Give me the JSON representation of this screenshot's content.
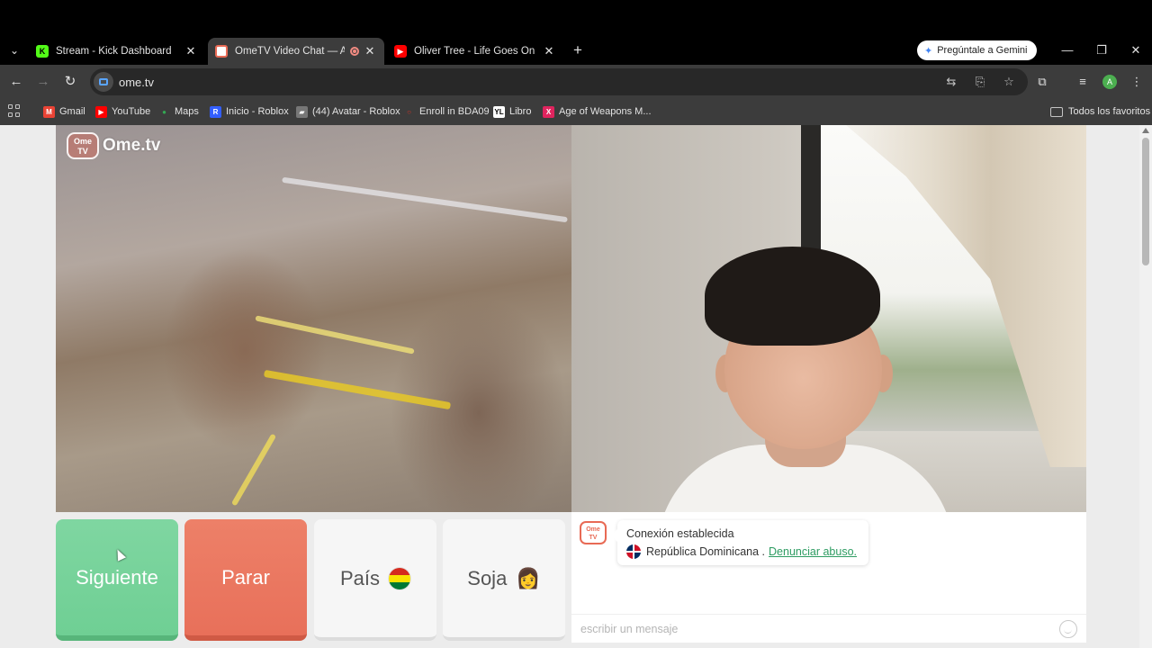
{
  "browser": {
    "tabs": [
      {
        "title": "Stream - Kick Dashboard",
        "active": false
      },
      {
        "title": "OmeTV Video Chat — Altern",
        "active": true
      },
      {
        "title": "Oliver Tree - Life Goes On [Musi",
        "active": false
      }
    ],
    "gemini_label": "Pregúntale a Gemini",
    "url": "ome.tv",
    "profile_initial": "A",
    "bookmarks": [
      {
        "label": "Gmail",
        "color": "#ea4335",
        "glyph": "M"
      },
      {
        "label": "YouTube",
        "color": "#ff0000",
        "glyph": "▶"
      },
      {
        "label": "Maps",
        "color": "#34a853",
        "glyph": "●"
      },
      {
        "label": "Inicio - Roblox",
        "color": "#335fff",
        "glyph": "R"
      },
      {
        "label": "(44) Avatar - Roblox",
        "color": "#777777",
        "glyph": "▰"
      },
      {
        "label": "Enroll in BDA09",
        "color": "#d93025",
        "glyph": "○"
      },
      {
        "label": "Libro",
        "color": "#444444",
        "glyph": "YL"
      },
      {
        "label": "Age of Weapons M...",
        "color": "#e0245e",
        "glyph": "X"
      }
    ],
    "all_bookmarks_label": "Todos los favoritos"
  },
  "video": {
    "logo_badge": "Ome TV",
    "logo_text": "Ome.tv"
  },
  "controls": {
    "next_label": "Siguiente",
    "stop_label": "Parar",
    "country_label": "País",
    "gender_label": "Soja",
    "gender_emoji": "👩"
  },
  "chat": {
    "status": "Conexión establecida",
    "country": "República Dominicana .",
    "report_link": "Denunciar abuso.",
    "input_placeholder": "escribir un mensaje"
  },
  "colors": {
    "next": "#6fcf94",
    "stop": "#e8705a",
    "link": "#2e9c62"
  }
}
